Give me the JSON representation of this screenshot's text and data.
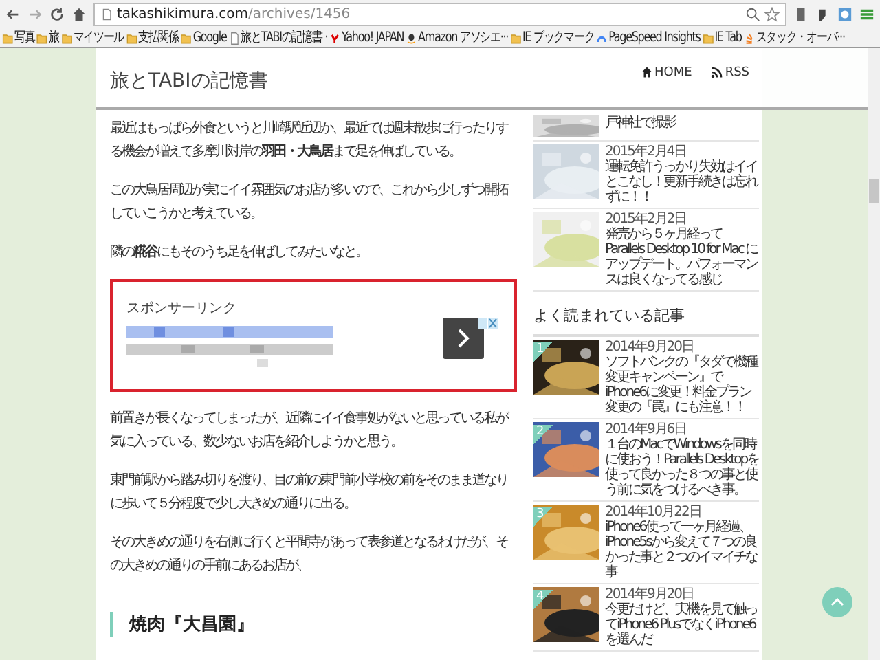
{
  "browser": {
    "url_domain": "takashikimura.com",
    "url_path": "/archives/1456",
    "bookmarks": [
      {
        "kind": "folder",
        "label": "写真"
      },
      {
        "kind": "folder",
        "label": "旅"
      },
      {
        "kind": "folder",
        "label": "マイツール"
      },
      {
        "kind": "folder",
        "label": "支払関係"
      },
      {
        "kind": "folder",
        "label": "Google"
      },
      {
        "kind": "page",
        "label": "旅とTABIの記憶書 ·"
      },
      {
        "kind": "yahoo",
        "label": "Yahoo! JAPAN"
      },
      {
        "kind": "amazon",
        "label": "Amazon アソシエ···"
      },
      {
        "kind": "folder",
        "label": "IE ブックマーク"
      },
      {
        "kind": "pagespeed",
        "label": "PageSpeed Insights"
      },
      {
        "kind": "folder",
        "label": "IE Tab"
      },
      {
        "kind": "stack",
        "label": "スタック・オーバ···"
      }
    ]
  },
  "header": {
    "title": "旅とTABIの記憶書",
    "nav": [
      {
        "kind": "home",
        "label": "HOME"
      },
      {
        "kind": "rss",
        "label": "RSS"
      }
    ]
  },
  "article": {
    "blocks": [
      {
        "kind": "paragraph",
        "text": "最近はもっぱら外食というと川崎駅近辺か、最近では週末散歩に行ったりする機会が増えて多摩川対岸の**羽田・大鳥居**まで足を伸ばしている。"
      },
      {
        "kind": "paragraph",
        "text": "この大鳥居周辺が実にイイ雰囲気のお店が多いので、これから少しずつ開拓していこうかと考えている。"
      },
      {
        "kind": "paragraph",
        "text": "隣の**糀谷**にもそのうち足を伸ばしてみたいなと。"
      },
      {
        "kind": "ad",
        "label": "スポンサーリンク"
      },
      {
        "kind": "paragraph",
        "text": "前置きが長くなってしまったが、近隣にイイ食事処がないと思っている私が気に入っている、数少ないお店を紹介しようかと思う。"
      },
      {
        "kind": "paragraph",
        "text": "東門前駅から踏み切りを渡り、目の前の東門前小学校の前をそのまま道なりに歩いて５分程度で少し大きめの通りに出る。"
      },
      {
        "kind": "paragraph",
        "text": "その大きめの通りを右側に行くと平間寺があって表参道となるわけだが、その大きめの通りの手前にあるお店が、"
      },
      {
        "kind": "heading",
        "text": "焼肉『大昌園』"
      }
    ]
  },
  "sidebar": {
    "recent": [
      {
        "title": "戸神社で撮影"
      },
      {
        "date": "2015年2月4日",
        "title": "運転免許うっかり失効はイイとこなし！更新手続きは忘れずに！！"
      },
      {
        "date": "2015年2月2日",
        "title": "発売から５ヶ月経って Parallels Desktop 10 for Mac にアップデート。パフォーマンスは良くなってる感じ"
      }
    ],
    "popular_title": "よく読まれている記事",
    "popular": [
      {
        "rank": "1",
        "date": "2014年9月20日",
        "title": "ソフトバンクの『タダで機種変更キャンペーン』でiPhone6に変更！料金プラン変更の『罠』にも注意！！"
      },
      {
        "rank": "2",
        "date": "2014年9月6日",
        "title": "１台のMacでWindowsを同時に使おう！Parallels Desktopを使って良かった８つの事と使う前に気をつけるべき事。"
      },
      {
        "rank": "3",
        "date": "2014年10月22日",
        "title": "iPhone6使って一ヶ月経過、iPhone5sから変えて７つの良かった事と２つのイマイチな事"
      },
      {
        "rank": "4",
        "date": "2014年9月20日",
        "title": "今更だけど、実機を見て触ってiPhone6 PlusでなくiPhone6を選んだ"
      }
    ]
  }
}
